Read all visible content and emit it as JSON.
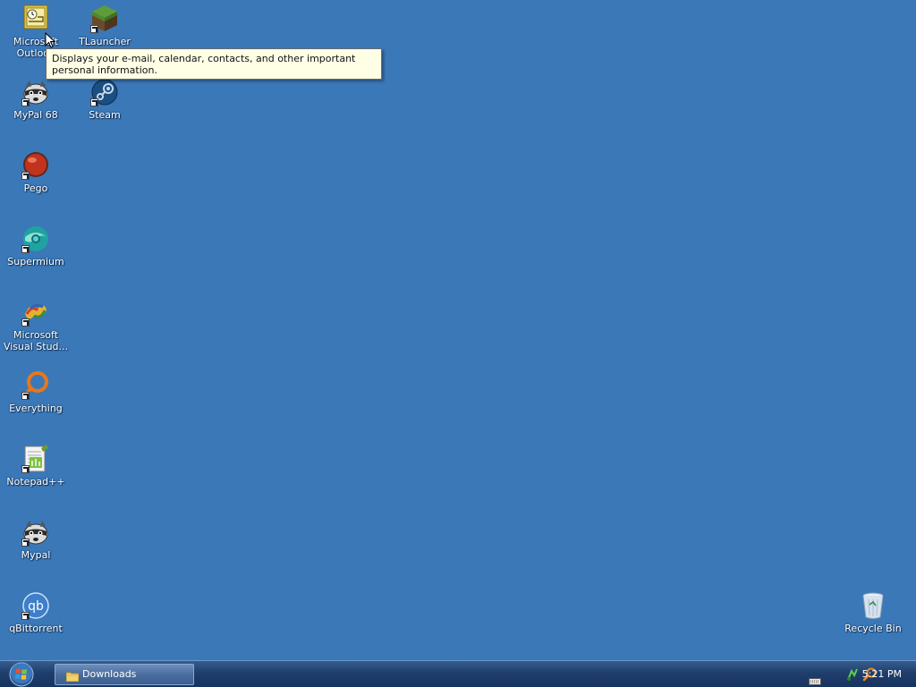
{
  "desktop": {
    "icons": [
      {
        "name": "outlook",
        "label": "Microsoft\nOutlook"
      },
      {
        "name": "tlauncher",
        "label": "TLauncher"
      },
      {
        "name": "mypal68",
        "label": "MyPal 68"
      },
      {
        "name": "steam",
        "label": "Steam"
      },
      {
        "name": "pego",
        "label": "Pego"
      },
      {
        "name": "supermium",
        "label": "Supermium"
      },
      {
        "name": "visual-studio",
        "label": "Microsoft\nVisual Stud..."
      },
      {
        "name": "everything",
        "label": "Everything"
      },
      {
        "name": "notepadpp",
        "label": "Notepad++"
      },
      {
        "name": "mypal",
        "label": "Mypal"
      },
      {
        "name": "qbittorrent",
        "label": "qBittorrent"
      },
      {
        "name": "recycle-bin",
        "label": "Recycle Bin"
      }
    ],
    "tooltip": "Displays your e-mail, calendar, contacts, and other important personal information."
  },
  "taskbar": {
    "task_downloads_label": "Downloads",
    "clock": "5:21 PM"
  },
  "colors": {
    "desktop_bg": "#3b78b8",
    "taskbar": "#1f3e6c",
    "tooltip_bg": "#ffffe6"
  }
}
